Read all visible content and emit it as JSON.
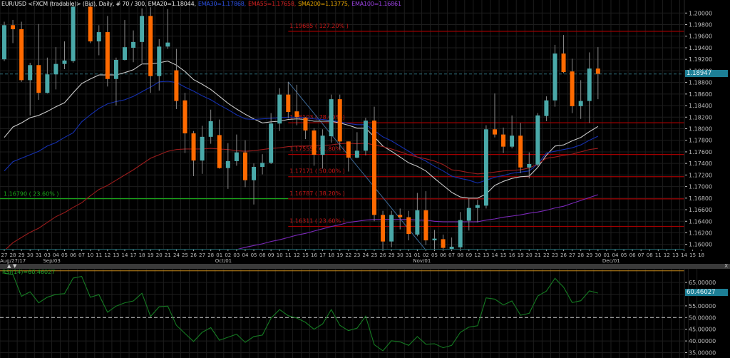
{
  "header": {
    "symbol": "EUR/USD <FXCM (tradable)> (Bid), Daily, # 70 / 300, EMA20=1.18044,",
    "ema30": "EMA30=1.17868,",
    "ema55": "EMA55=1.17658,",
    "sma200": "SMA200=1.13775,",
    "ema100": "EMA100=1.16861"
  },
  "last_price": "1.18947",
  "rsi_panel": {
    "label": "RSI(14)=60.46027",
    "last_value": "60.46027",
    "up_icon": "triangle-up-icon",
    "down_icon": "triangle-down-icon",
    "close_label": "X"
  },
  "colors": {
    "bull": "#4aa9a9",
    "bear": "#ff6a00",
    "wick": "#8a8a8a",
    "ema20": "#c8c8c8",
    "ema30": "#1530b0",
    "ema55": "#9a1c1c",
    "ema100": "#7a28b8",
    "sma200": "#e0a000",
    "fib": "#a00000",
    "fib_green": "#1aa51a",
    "trendline": "#3d6a99",
    "rsi": "#157a22",
    "rsi_70": "#c88a1a",
    "price_badge": "#1d7f96"
  },
  "chart_data": {
    "type": "candlestick",
    "ylim": [
      1.1595,
      1.20226
    ],
    "y_ticks": [
      "1.20000",
      "1.19800",
      "1.19600",
      "1.19400",
      "1.19200",
      "1.19000",
      "1.18800",
      "1.18600",
      "1.18400",
      "1.18200",
      "1.18000",
      "1.17800",
      "1.17600",
      "1.17400",
      "1.17200",
      "1.17000",
      "1.16800",
      "1.16600",
      "1.16400",
      "1.16200",
      "1.16000"
    ],
    "x_tick_labels": [
      "27",
      "28",
      "29",
      "30",
      "31",
      "03",
      "04",
      "05",
      "06",
      "07",
      "10",
      "11",
      "12",
      "13",
      "14",
      "17",
      "18",
      "19",
      "20",
      "21",
      "24",
      "25",
      "26",
      "27",
      "28",
      "01",
      "02",
      "03",
      "04",
      "05",
      "08",
      "09",
      "10",
      "11",
      "12",
      "15",
      "16",
      "17",
      "18",
      "19",
      "22",
      "23",
      "24",
      "25",
      "26",
      "29",
      "30",
      "31",
      "01",
      "02",
      "05",
      "06",
      "07",
      "08",
      "09",
      "12",
      "13",
      "14",
      "15",
      "16",
      "19",
      "20",
      "21",
      "22",
      "23",
      "26",
      "27",
      "28",
      "29",
      "30",
      "01",
      "04",
      "05",
      "06",
      "07",
      "08",
      "11",
      "12",
      "13",
      "14",
      "15",
      "18"
    ],
    "month_labels": [
      {
        "label": "Aug/27/17",
        "tick": 0
      },
      {
        "label": "Sep/03",
        "tick": 5
      },
      {
        "label": "Oct/01",
        "tick": 25
      },
      {
        "label": "Nov/01",
        "tick": 48
      },
      {
        "label": "Dec/01",
        "tick": 70
      }
    ],
    "ohlc_fields": [
      "open",
      "high",
      "low",
      "close"
    ],
    "ohlc": [
      [
        1.192,
        1.1985,
        1.1917,
        1.1979
      ],
      [
        1.1979,
        1.1988,
        1.1948,
        1.1972
      ],
      [
        1.1972,
        1.1985,
        1.1881,
        1.1884
      ],
      [
        1.1884,
        1.1914,
        1.1823,
        1.191
      ],
      [
        1.191,
        1.1981,
        1.185,
        1.1862
      ],
      [
        1.1862,
        1.1923,
        1.1861,
        1.1894
      ],
      [
        1.1894,
        1.1941,
        1.1868,
        1.1912
      ],
      [
        1.1912,
        1.1951,
        1.1903,
        1.1918
      ],
      [
        1.1917,
        1.2019,
        1.1914,
        1.2011
      ],
      [
        1.2035,
        1.2092,
        1.2027,
        1.204
      ],
      [
        1.2011,
        1.2016,
        1.1948,
        1.1951
      ],
      [
        1.1951,
        1.1979,
        1.1927,
        1.1967
      ],
      [
        1.1967,
        1.1995,
        1.1873,
        1.1886
      ],
      [
        1.1886,
        1.1923,
        1.184,
        1.1919
      ],
      [
        1.1919,
        1.1988,
        1.1918,
        1.1941
      ],
      [
        1.194,
        1.197,
        1.1915,
        1.195
      ],
      [
        1.195,
        1.2008,
        1.1914,
        1.1995
      ],
      [
        1.1995,
        1.201,
        1.1862,
        1.1891
      ],
      [
        1.1891,
        1.1955,
        1.1866,
        1.1942
      ],
      [
        1.1942,
        1.2007,
        1.1938,
        1.1949
      ],
      [
        1.1901,
        1.1938,
        1.1834,
        1.1848
      ],
      [
        1.1849,
        1.1862,
        1.1758,
        1.1792
      ],
      [
        1.1792,
        1.1796,
        1.1718,
        1.1745
      ],
      [
        1.1745,
        1.1805,
        1.1722,
        1.1786
      ],
      [
        1.1786,
        1.1833,
        1.1774,
        1.1813
      ],
      [
        1.1789,
        1.1816,
        1.1731,
        1.1732
      ],
      [
        1.1732,
        1.1775,
        1.1696,
        1.1744
      ],
      [
        1.1744,
        1.179,
        1.1736,
        1.1759
      ],
      [
        1.1759,
        1.178,
        1.1699,
        1.1711
      ],
      [
        1.1711,
        1.174,
        1.1669,
        1.1734
      ],
      [
        1.1734,
        1.1756,
        1.1721,
        1.1741
      ],
      [
        1.1741,
        1.1827,
        1.1739,
        1.1809
      ],
      [
        1.1809,
        1.187,
        1.1796,
        1.1859
      ],
      [
        1.1859,
        1.1881,
        1.1818,
        1.1829
      ],
      [
        1.183,
        1.1876,
        1.1806,
        1.182
      ],
      [
        1.1819,
        1.182,
        1.1782,
        1.1797
      ],
      [
        1.1797,
        1.1801,
        1.1736,
        1.1755
      ],
      [
        1.1755,
        1.1799,
        1.1731,
        1.1788
      ],
      [
        1.1787,
        1.1859,
        1.1776,
        1.1851
      ],
      [
        1.1851,
        1.1859,
        1.1764,
        1.1778
      ],
      [
        1.1778,
        1.1778,
        1.1726,
        1.175
      ],
      [
        1.175,
        1.1794,
        1.1749,
        1.1762
      ],
      [
        1.1762,
        1.1819,
        1.1754,
        1.1814
      ],
      [
        1.1814,
        1.1838,
        1.164,
        1.1651
      ],
      [
        1.1651,
        1.1658,
        1.1591,
        1.1605
      ],
      [
        1.1605,
        1.1658,
        1.1595,
        1.1651
      ],
      [
        1.1651,
        1.1662,
        1.1626,
        1.1647
      ],
      [
        1.1647,
        1.1658,
        1.1607,
        1.1618
      ],
      [
        1.1617,
        1.1689,
        1.1614,
        1.1659
      ],
      [
        1.1659,
        1.1692,
        1.1599,
        1.1607
      ],
      [
        1.1607,
        1.1625,
        1.1591,
        1.161
      ],
      [
        1.1609,
        1.1617,
        1.159,
        1.1594
      ],
      [
        1.1592,
        1.1612,
        1.1588,
        1.1596
      ],
      [
        1.1595,
        1.1656,
        1.1591,
        1.1642
      ],
      [
        1.1641,
        1.168,
        1.1624,
        1.1663
      ],
      [
        1.1663,
        1.1677,
        1.1638,
        1.1668
      ],
      [
        1.1667,
        1.1806,
        1.1662,
        1.1799
      ],
      [
        1.1799,
        1.1861,
        1.1785,
        1.179
      ],
      [
        1.179,
        1.1802,
        1.1758,
        1.1769
      ],
      [
        1.1769,
        1.1823,
        1.1766,
        1.1788
      ],
      [
        1.1788,
        1.181,
        1.1723,
        1.1733
      ],
      [
        1.1733,
        1.1759,
        1.1714,
        1.1739
      ],
      [
        1.1738,
        1.1827,
        1.1735,
        1.1823
      ],
      [
        1.1822,
        1.1856,
        1.1813,
        1.1849
      ],
      [
        1.1849,
        1.1945,
        1.1838,
        1.193
      ],
      [
        1.193,
        1.1962,
        1.1896,
        1.1898
      ],
      [
        1.1899,
        1.1921,
        1.1827,
        1.1839
      ],
      [
        1.1839,
        1.1884,
        1.1817,
        1.1848
      ],
      [
        1.1848,
        1.1932,
        1.181,
        1.1904
      ],
      [
        1.1904,
        1.1941,
        1.1851,
        1.1895
      ]
    ],
    "series": [
      {
        "name": "EMA20",
        "color_key": "ema20",
        "values": [
          1.1785,
          1.1803,
          1.181,
          1.1819,
          1.1823,
          1.183,
          1.1838,
          1.1845,
          1.1862,
          1.1878,
          1.1886,
          1.1893,
          1.1893,
          1.1893,
          1.1897,
          1.1902,
          1.1912,
          1.1912,
          1.1914,
          1.1917,
          1.191,
          1.1899,
          1.1885,
          1.1877,
          1.1868,
          1.1856,
          1.1844,
          1.1834,
          1.1825,
          1.1817,
          1.181,
          1.1812,
          1.1813,
          1.1816,
          1.1817,
          1.1816,
          1.1813,
          1.1813,
          1.1813,
          1.181,
          1.1806,
          1.1801,
          1.1801,
          1.1786,
          1.177,
          1.1761,
          1.1751,
          1.1741,
          1.1735,
          1.1727,
          1.1714,
          1.1702,
          1.169,
          1.1682,
          1.168,
          1.168,
          1.1687,
          1.1702,
          1.1709,
          1.1714,
          1.1717,
          1.1718,
          1.1733,
          1.1754,
          1.177,
          1.1772,
          1.1779,
          1.1785,
          1.1795,
          1.1804
        ]
      },
      {
        "name": "EMA30",
        "color_key": "ema30",
        "values": [
          1.1727,
          1.1743,
          1.1749,
          1.1755,
          1.1761,
          1.177,
          1.1776,
          1.1785,
          1.1793,
          1.1812,
          1.1824,
          1.1835,
          1.1843,
          1.1847,
          1.185,
          1.1856,
          1.1864,
          1.1872,
          1.1881,
          1.1882,
          1.188,
          1.1872,
          1.1865,
          1.1857,
          1.185,
          1.1841,
          1.1833,
          1.1824,
          1.1817,
          1.1816,
          1.1817,
          1.1818,
          1.1819,
          1.182,
          1.182,
          1.1819,
          1.1817,
          1.1816,
          1.1814,
          1.1812,
          1.1809,
          1.1807,
          1.1807,
          1.1797,
          1.1786,
          1.1779,
          1.177,
          1.1761,
          1.1751,
          1.1744,
          1.1735,
          1.1727,
          1.1718,
          1.1714,
          1.1711,
          1.1706,
          1.1711,
          1.1716,
          1.1719,
          1.1723,
          1.1725,
          1.1727,
          1.1739,
          1.1758,
          1.1761,
          1.1764,
          1.1767,
          1.1772,
          1.178,
          1.1787
        ]
      },
      {
        "name": "EMA55",
        "color_key": "ema55",
        "values": [
          1.1589,
          1.1603,
          1.1612,
          1.1621,
          1.1628,
          1.1638,
          1.1648,
          1.1655,
          1.1664,
          1.1672,
          1.1684,
          1.1695,
          1.1702,
          1.1711,
          1.172,
          1.1729,
          1.1739,
          1.1749,
          1.1755,
          1.1761,
          1.1764,
          1.1765,
          1.1765,
          1.1765,
          1.1766,
          1.1765,
          1.1764,
          1.1762,
          1.1761,
          1.1762,
          1.1764,
          1.1766,
          1.1767,
          1.1769,
          1.177,
          1.177,
          1.1771,
          1.1771,
          1.1772,
          1.1774,
          1.1775,
          1.1774,
          1.1775,
          1.1772,
          1.1769,
          1.1765,
          1.176,
          1.1755,
          1.1751,
          1.1748,
          1.1744,
          1.1738,
          1.1729,
          1.1727,
          1.1724,
          1.1722,
          1.1723,
          1.1725,
          1.1727,
          1.1728,
          1.1729,
          1.1732,
          1.1739,
          1.1749,
          1.1751,
          1.1754,
          1.1756,
          1.176,
          1.1764,
          1.1766
        ]
      },
      {
        "name": "EMA100",
        "color_key": "ema100",
        "values": [
          null,
          null,
          null,
          null,
          null,
          null,
          null,
          null,
          null,
          null,
          null,
          null,
          null,
          null,
          null,
          null,
          null,
          null,
          null,
          null,
          null,
          null,
          null,
          null,
          null,
          null,
          null,
          1.1591,
          1.1595,
          1.1598,
          1.1601,
          1.1605,
          1.1608,
          1.1612,
          1.1616,
          1.1619,
          1.1623,
          1.1627,
          1.1631,
          1.1634,
          1.1638,
          1.164,
          1.1642,
          1.1643,
          1.1643,
          1.1643,
          1.1643,
          1.1643,
          1.1642,
          1.1642,
          1.164,
          1.1639,
          1.1639,
          1.1639,
          1.1639,
          1.1639,
          1.1642,
          1.1644,
          1.1647,
          1.1649,
          1.1651,
          1.1654,
          1.1656,
          1.1659,
          1.1663,
          1.1666,
          1.1671,
          1.1676,
          1.1681,
          1.1686
        ]
      }
    ],
    "fibonacci": [
      {
        "price": 1.19685,
        "label": "1.19685 ( 127.20% )"
      },
      {
        "price": 1.18103,
        "label": "1.18103 ( 78.60% )"
      },
      {
        "price": 1.17555,
        "label": "1.17555 ( 61.80% )"
      },
      {
        "price": 1.17171,
        "label": "1.17171 ( 50.00% )"
      },
      {
        "price": 1.16787,
        "label": "1.16787 ( 38.20% )"
      },
      {
        "price": 1.16311,
        "label": "1.16311 ( 23.60% )"
      }
    ],
    "fib_start_candle": 34,
    "green_level": {
      "price": 1.1679,
      "label": "1.16790 ( 23.60% )"
    },
    "trendline": {
      "from": {
        "candle": 34,
        "price": 1.1881
      },
      "to": {
        "candle": 50,
        "price": 1.159
      }
    }
  },
  "rsi_chart": {
    "type": "line",
    "period": 14,
    "ylim": [
      32.8,
      70.6
    ],
    "y_ticks": [
      "65.00000",
      "55.00000",
      "50.00000",
      "45.00000",
      "40.00000",
      "35.00000"
    ],
    "levels": [
      70,
      50
    ],
    "values": [
      68.9,
      68.4,
      59.1,
      61.0,
      56.3,
      58.7,
      59.9,
      60.2,
      66.9,
      67.6,
      58.7,
      59.8,
      52.3,
      54.9,
      56.3,
      57.1,
      60.4,
      50.5,
      54.6,
      54.9,
      46.7,
      43.2,
      39.8,
      43.7,
      45.7,
      40.3,
      41.6,
      42.9,
      39.4,
      41.9,
      42.5,
      49.8,
      53.4,
      50.8,
      49.8,
      48.0,
      45.0,
      47.3,
      53.4,
      46.7,
      44.4,
      45.5,
      50.6,
      38.4,
      35.8,
      40.1,
      39.6,
      38.1,
      41.9,
      38.6,
      38.8,
      37.1,
      38.1,
      43.7,
      45.9,
      46.5,
      58.4,
      57.9,
      55.4,
      57.1,
      51.0,
      51.8,
      59.2,
      61.3,
      66.8,
      63.0,
      56.4,
      57.2,
      61.4,
      60.46
    ]
  }
}
